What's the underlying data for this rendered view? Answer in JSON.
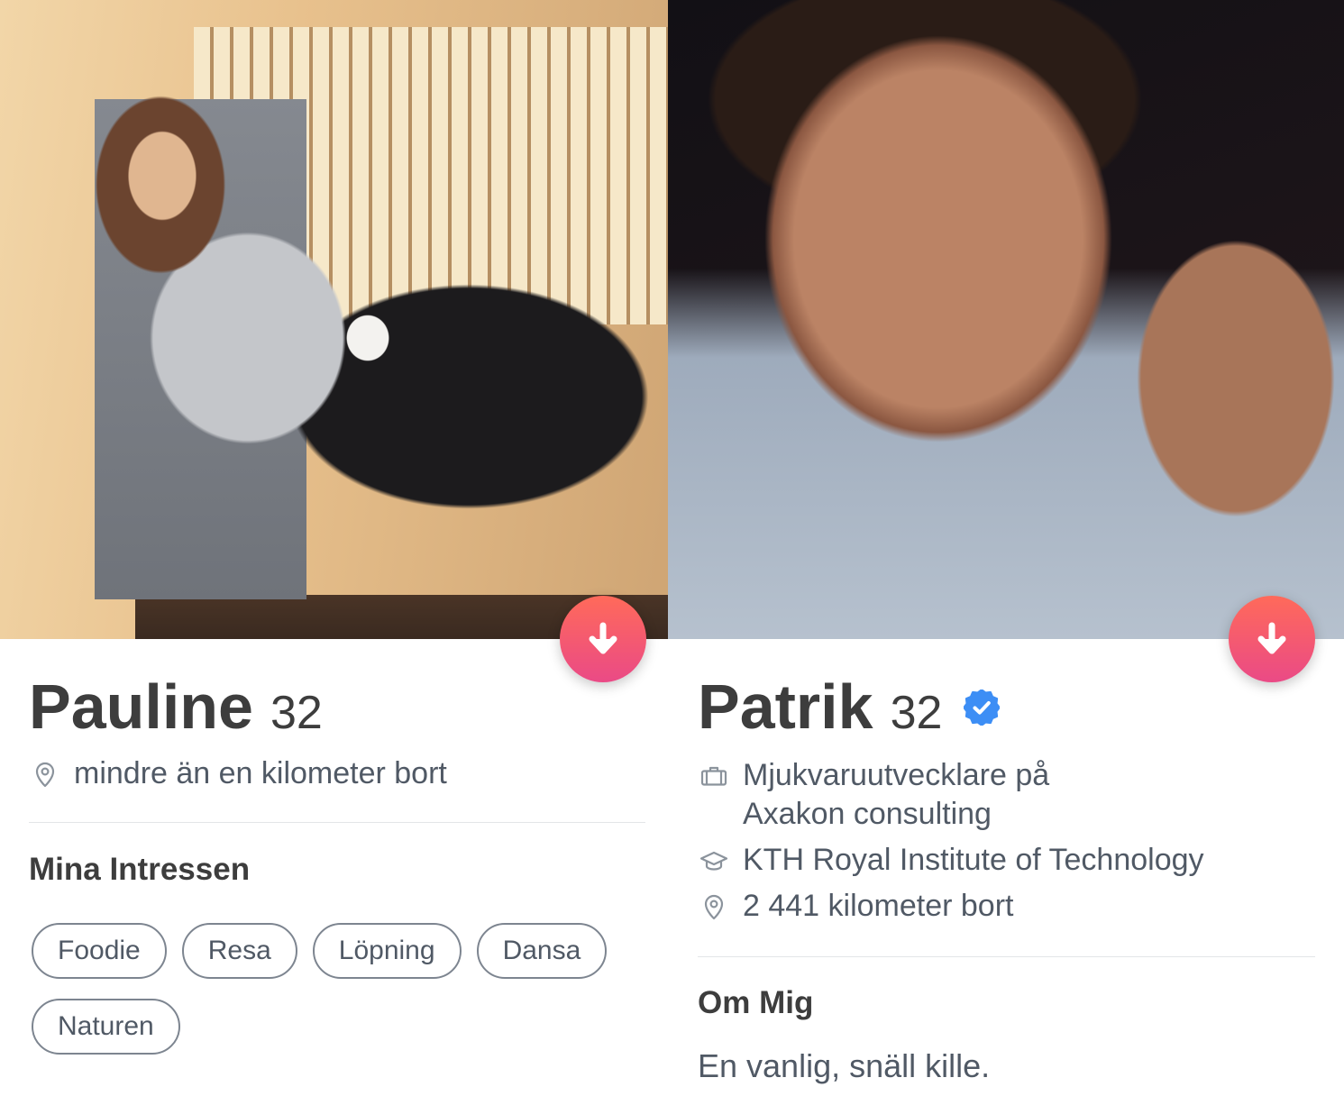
{
  "profiles": [
    {
      "name": "Pauline",
      "age": "32",
      "details": [
        {
          "icon": "location-pin-icon",
          "text": "mindre än en kilometer bort"
        }
      ],
      "section_title": "Mina Intressen",
      "interests": [
        "Foodie",
        "Resa",
        "Löpning",
        "Dansa",
        "Naturen"
      ],
      "expand_button_icon": "arrow-down-icon"
    },
    {
      "name": "Patrik",
      "age": "32",
      "verified": true,
      "verified_icon": "verified-badge-icon",
      "details": [
        {
          "icon": "briefcase-icon",
          "text": "Mjukvaruutvecklare på Axakon consulting"
        },
        {
          "icon": "graduation-cap-icon",
          "text": "KTH Royal Institute of Technology"
        },
        {
          "icon": "location-pin-icon",
          "text": "2 441 kilometer bort"
        }
      ],
      "section_title": "Om Mig",
      "bio": "En vanlig, snäll kille.",
      "expand_button_icon": "arrow-down-icon"
    }
  ],
  "colors": {
    "text_primary": "#3d3d3d",
    "text_secondary": "#505965",
    "icon_gray": "#8b939c",
    "divider": "#e3e5e8",
    "pill_border": "#7d8590",
    "accent_gradient_top": "#ff6a5a",
    "accent_gradient_bottom": "#ea4a86",
    "verified_blue": "#3d8ef5"
  }
}
